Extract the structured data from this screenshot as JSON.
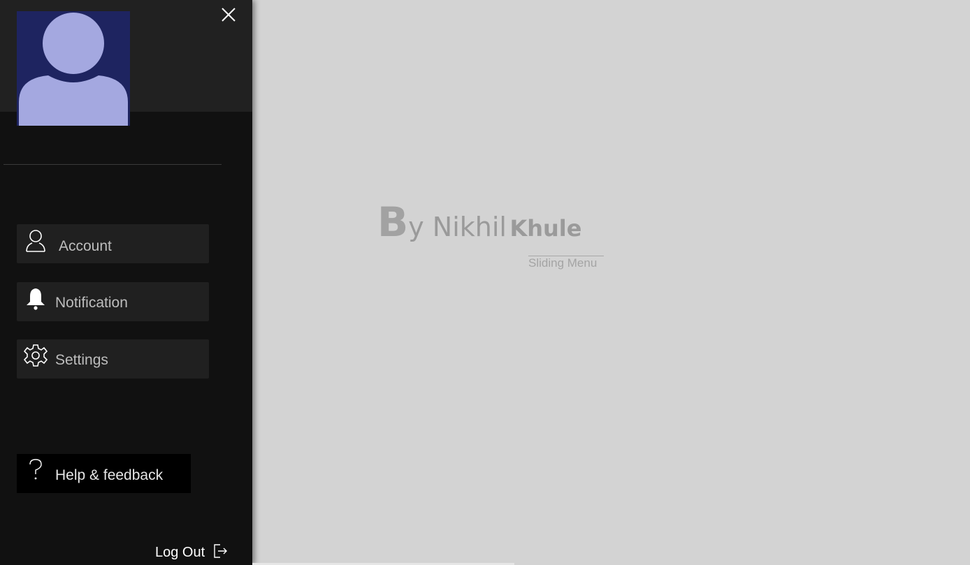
{
  "sidebar": {
    "close_icon": "close-icon",
    "avatar_icon": "user-avatar-icon",
    "menu": [
      {
        "label": "Account",
        "icon": "user-icon"
      },
      {
        "label": "Notification",
        "icon": "bell-icon"
      },
      {
        "label": "Settings",
        "icon": "gear-icon"
      }
    ],
    "help": {
      "label": "Help & feedback",
      "icon": "question-icon"
    },
    "logout": {
      "label": "Log Out",
      "icon": "logout-icon"
    }
  },
  "main": {
    "credit_first_letter": "B",
    "credit_rest": "y Nikhil",
    "credit_last": "Khule",
    "subtitle": "Sliding Menu"
  },
  "colors": {
    "sidebar_bg": "#111111",
    "sidebar_header_bg": "#212121",
    "avatar_bg": "#1e2460",
    "avatar_fg": "#a4a8e0",
    "main_bg": "#d3d3d3",
    "menu_item_bg": "#202020"
  }
}
